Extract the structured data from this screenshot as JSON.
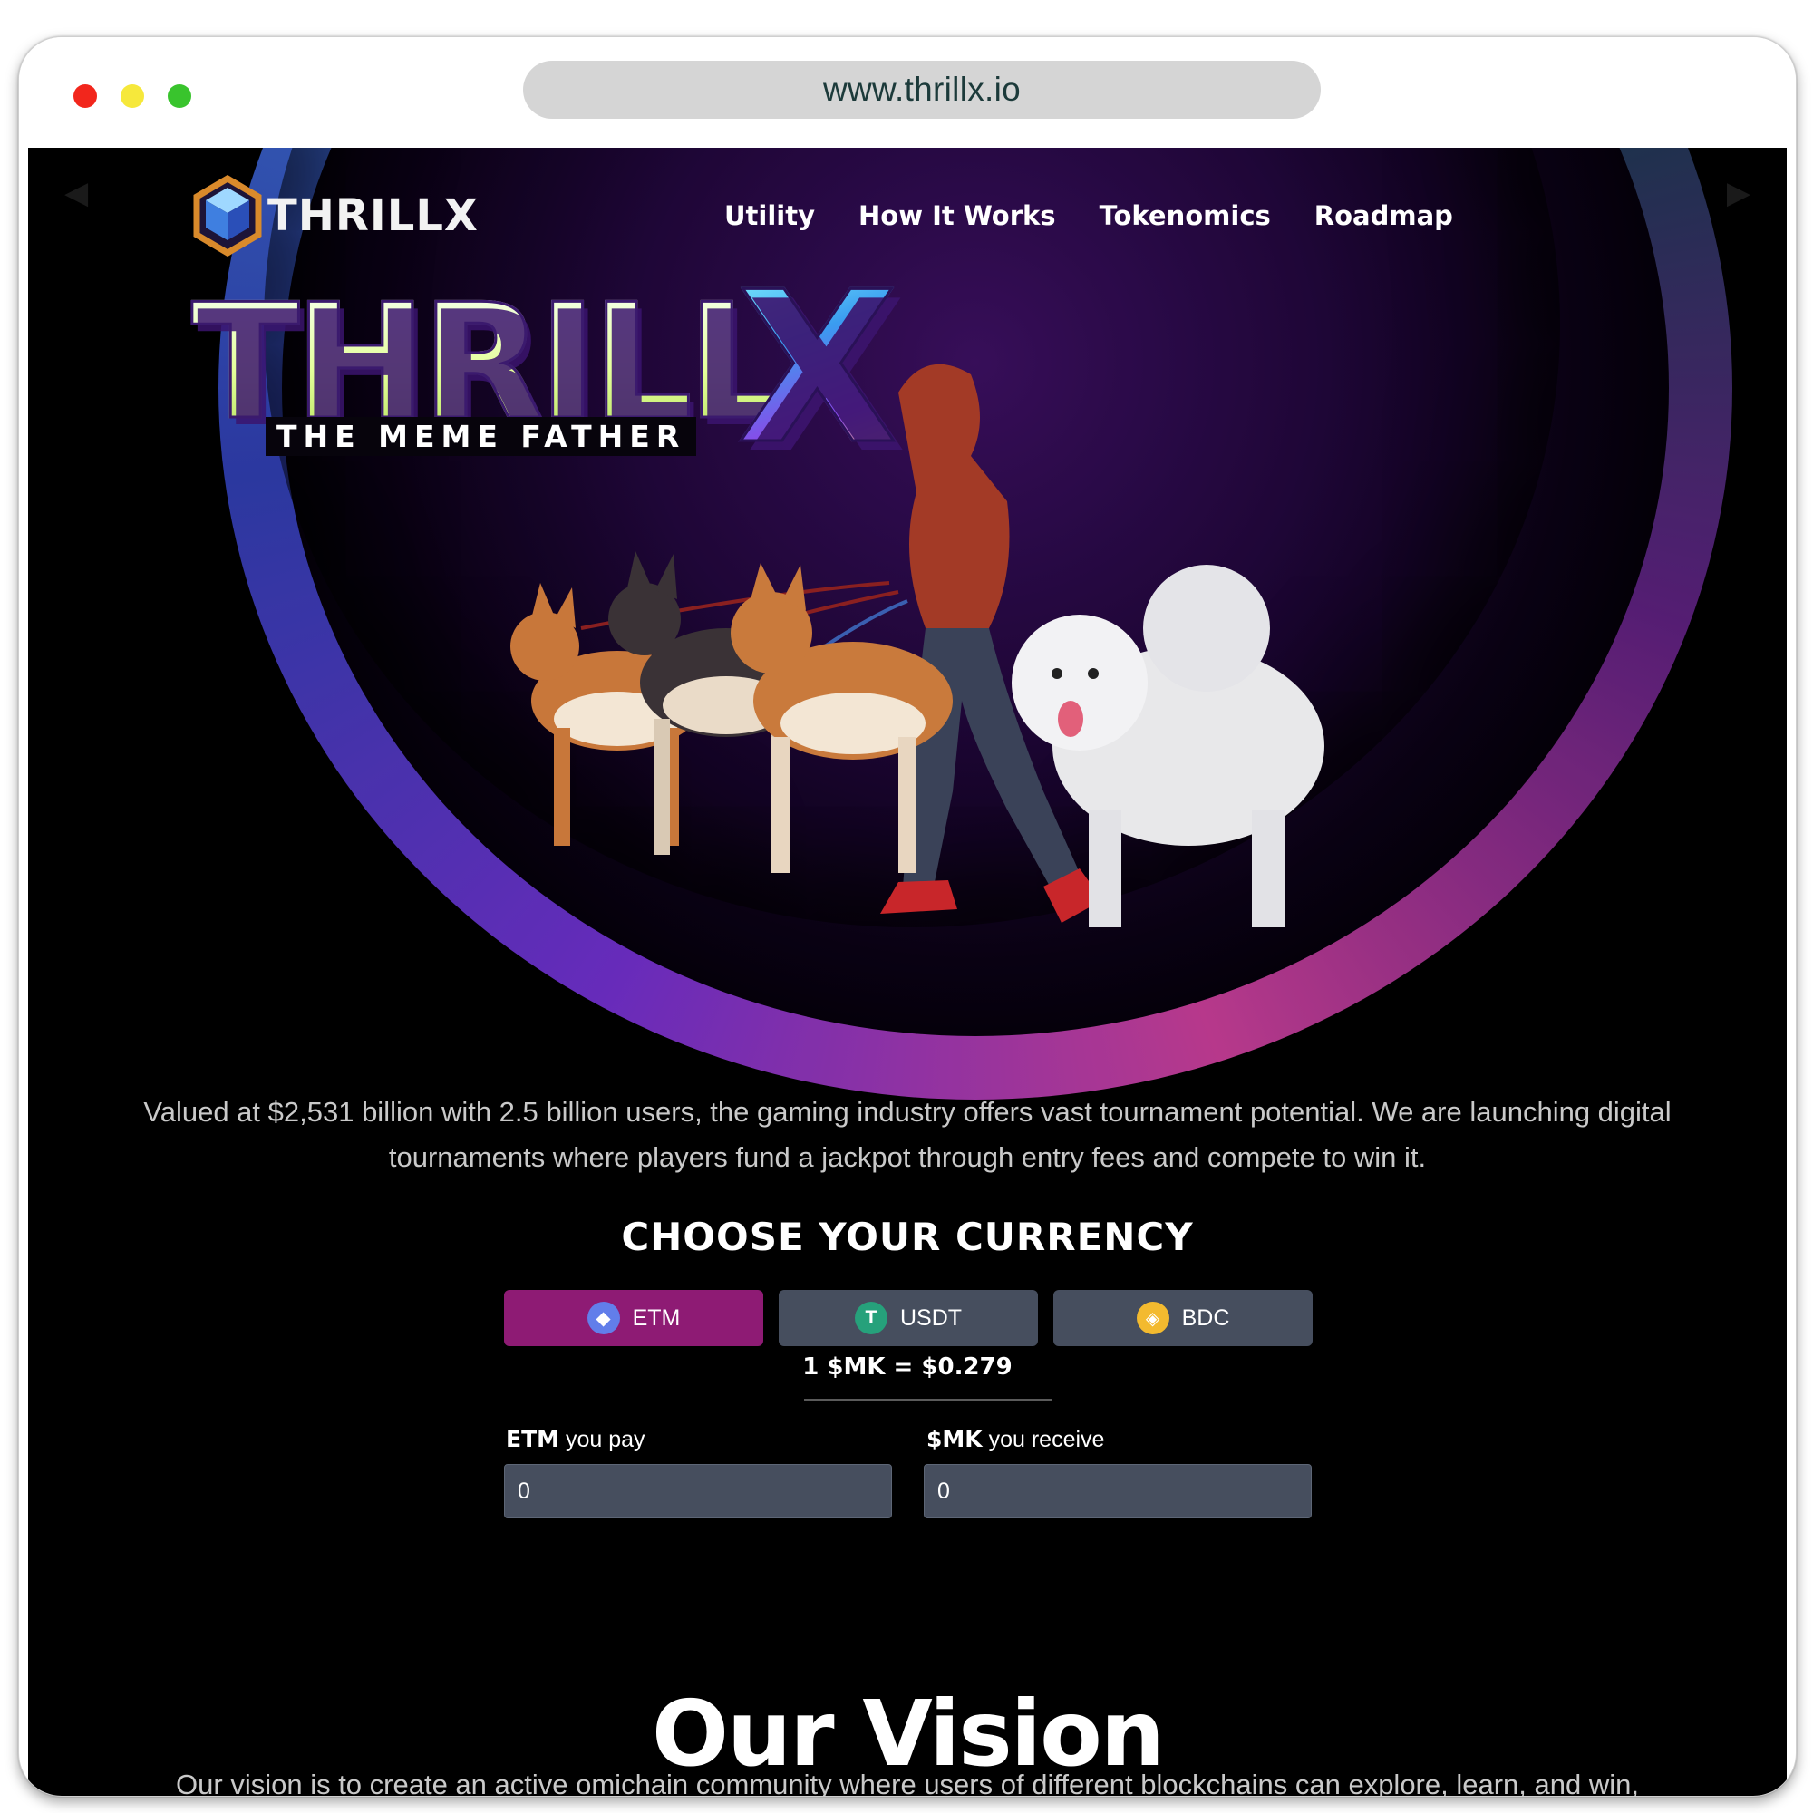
{
  "browser": {
    "url": "www.thrillx.io"
  },
  "header": {
    "logo_text": "THRILLX",
    "nav": [
      "Utility",
      "How It Works",
      "Tokenomics",
      "Roadmap"
    ]
  },
  "hero": {
    "title": "THRILL",
    "title_x": "X",
    "subtitle": "THE MEME FATHER",
    "art_description_icon": "hooded-figure-walking-dogs-illustration"
  },
  "intro": {
    "text": "Valued at $2,531 billion with 2.5 billion users, the gaming industry offers vast tournament potential. We are launching digital tournaments where players fund a jackpot through entry fees and compete to win it."
  },
  "presale": {
    "heading": "CHOOSE YOUR CURRENCY",
    "currencies": [
      {
        "label": "ETM",
        "icon": "ethereum-icon",
        "active": true
      },
      {
        "label": "USDT",
        "icon": "tether-icon",
        "active": false
      },
      {
        "label": "BDC",
        "icon": "binance-icon",
        "active": false
      }
    ],
    "rate": "1 $MK = $0.279",
    "pay_label_bold": "ETM",
    "pay_label_rest": " you pay",
    "receive_label_bold": "$MK",
    "receive_label_rest": " you receive",
    "pay_value": "0",
    "receive_value": "0"
  },
  "vision": {
    "title": "Our Vision",
    "text": "Our vision is to create an active omichain community where users of different blockchains can explore, learn, and win,"
  },
  "colors": {
    "active_currency": "#8e1b74",
    "inactive_currency": "#464e5e",
    "background": "#000000"
  }
}
